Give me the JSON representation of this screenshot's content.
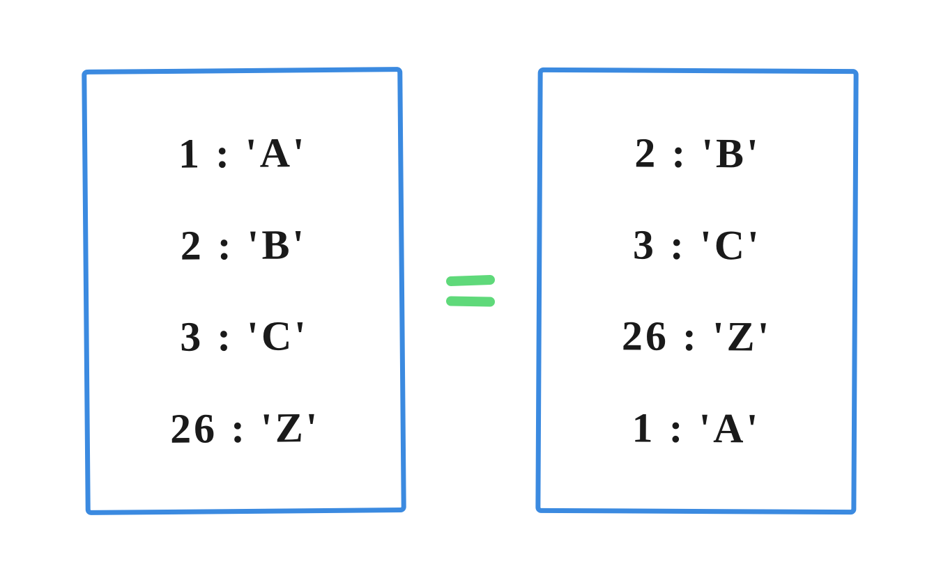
{
  "left_box": {
    "rows": [
      "1 : 'A'",
      "2 : 'B'",
      "3 : 'C'",
      "26 : 'Z'"
    ]
  },
  "right_box": {
    "rows": [
      "2 : 'B'",
      "3 : 'C'",
      "26 : 'Z'",
      "1 : 'A'"
    ]
  },
  "operator": "=",
  "concept": "dictionary-equality-unordered",
  "colors": {
    "box_border": "#3b8ae0",
    "text": "#1a1a1a",
    "equals": "#5fd97a"
  }
}
